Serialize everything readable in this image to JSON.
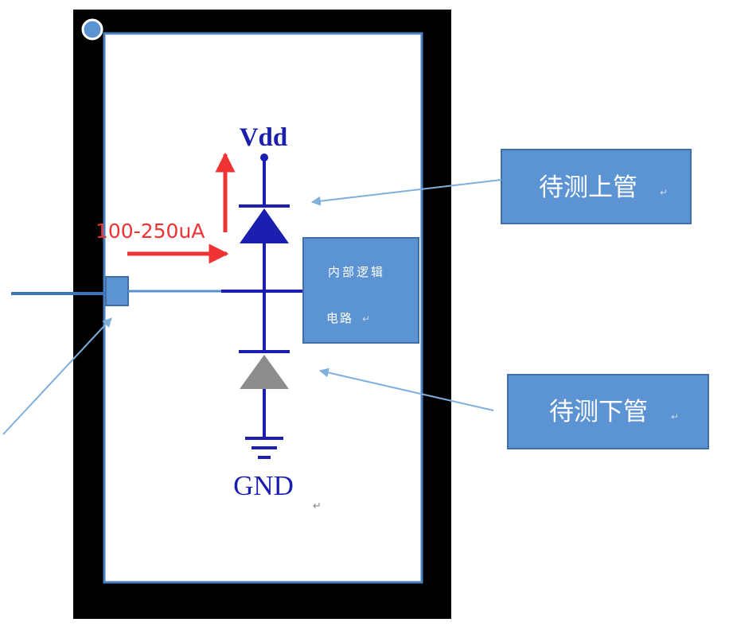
{
  "labels": {
    "vdd": "Vdd",
    "gnd": "GND",
    "current": "100-250uA",
    "logic_line1": "内部逻辑",
    "logic_line2": "电路",
    "upper_callout": "待测上管",
    "lower_callout": "待测下管",
    "return_mark": "↵"
  },
  "colors": {
    "package": "#000000",
    "die_border": "#4a7fc0",
    "callout_fill": "#5b93d3",
    "callout_border": "#3f6fa6",
    "circuit": "#1a1fb0",
    "current_arrow": "#ef3333",
    "lower_diode": "#8c8c8c",
    "leader_line": "#7fb0dc"
  }
}
